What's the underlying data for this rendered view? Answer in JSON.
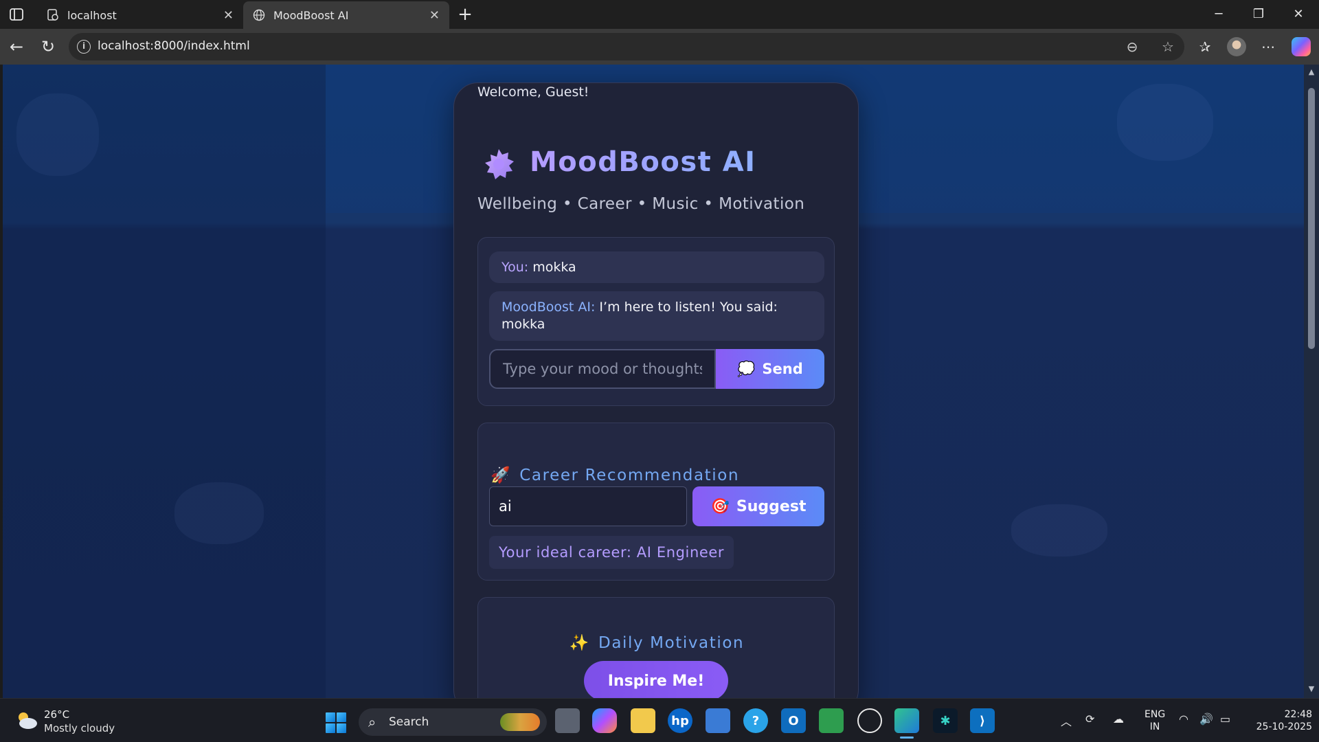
{
  "browser": {
    "tabs": [
      {
        "title": "localhost",
        "icon": "localhost-favicon"
      },
      {
        "title": "MoodBoost AI",
        "icon": "globe-icon"
      }
    ],
    "url": "localhost:8000/index.html"
  },
  "app": {
    "welcome": "Welcome, Guest!",
    "title": "MoodBoost AI",
    "tagline": "Wellbeing • Career • Music • Motivation",
    "chat": {
      "messages": [
        {
          "speaker": "You:",
          "text": " mokka"
        },
        {
          "speaker": "MoodBoost AI:",
          "text": " I’m here to listen! You said: mokka"
        }
      ],
      "input_placeholder": "Type your mood or thoughts...",
      "send_label": "Send",
      "send_emoji": "💭"
    },
    "career": {
      "emoji": "🚀",
      "heading": "Career Recommendation",
      "input_value": "ai",
      "suggest_emoji": "🎯",
      "suggest_label": "Suggest",
      "result": "Your ideal career: AI Engineer"
    },
    "motivation": {
      "emoji": "✨",
      "heading": "Daily Motivation",
      "button_label": "Inspire Me!"
    },
    "colors": {
      "accent_purple": "#8a5cf5",
      "accent_blue": "#5b8bf7",
      "card_bg": "#1f2338"
    }
  },
  "taskbar": {
    "weather_temp": "26°C",
    "weather_desc": "Mostly cloudy",
    "search_label": "Search",
    "lang_top": "ENG",
    "lang_bottom": "IN",
    "time": "22:48",
    "date": "25-10-2025"
  }
}
